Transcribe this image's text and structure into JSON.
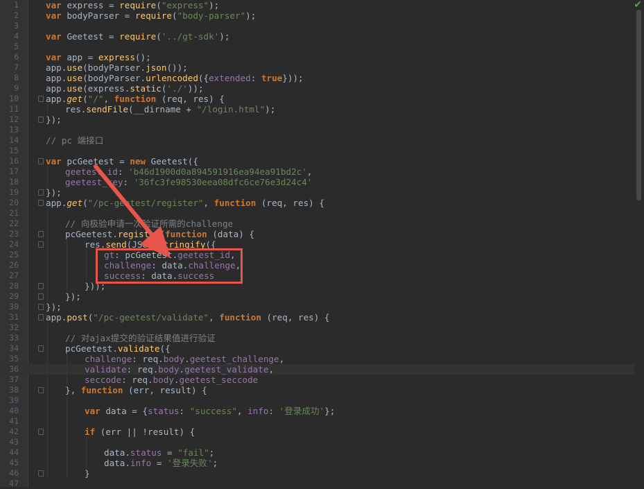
{
  "editor": {
    "accent_color": "#e8554a",
    "status_icon": "check-icon",
    "status_glyph": "✔",
    "current_line": 36,
    "lines": [
      {
        "n": "1",
        "fold": false,
        "indent": 0,
        "tokens": [
          [
            "k",
            "var"
          ],
          [
            "p",
            " express = "
          ],
          [
            "m",
            "require"
          ],
          [
            "p",
            "("
          ],
          [
            "s",
            "\"express\""
          ],
          [
            "p",
            ");"
          ]
        ]
      },
      {
        "n": "2",
        "fold": false,
        "indent": 0,
        "tokens": [
          [
            "k",
            "var"
          ],
          [
            "p",
            " bodyParser = "
          ],
          [
            "m",
            "require"
          ],
          [
            "p",
            "("
          ],
          [
            "s",
            "\"body-parser\""
          ],
          [
            "p",
            ");"
          ]
        ]
      },
      {
        "n": "3",
        "fold": false,
        "indent": 0,
        "tokens": []
      },
      {
        "n": "4",
        "fold": false,
        "indent": 0,
        "tokens": [
          [
            "k",
            "var"
          ],
          [
            "p",
            " Geetest = "
          ],
          [
            "m",
            "require"
          ],
          [
            "p",
            "("
          ],
          [
            "s",
            "'../gt-sdk'"
          ],
          [
            "p",
            ");"
          ]
        ]
      },
      {
        "n": "5",
        "fold": false,
        "indent": 0,
        "tokens": []
      },
      {
        "n": "6",
        "fold": false,
        "indent": 0,
        "tokens": [
          [
            "k",
            "var"
          ],
          [
            "p",
            " app = "
          ],
          [
            "m",
            "express"
          ],
          [
            "p",
            "();"
          ]
        ]
      },
      {
        "n": "7",
        "fold": false,
        "indent": 0,
        "tokens": [
          [
            "p",
            "app."
          ],
          [
            "m",
            "use"
          ],
          [
            "p",
            "(bodyParser."
          ],
          [
            "m",
            "json"
          ],
          [
            "p",
            "());"
          ]
        ]
      },
      {
        "n": "8",
        "fold": false,
        "indent": 0,
        "tokens": [
          [
            "p",
            "app."
          ],
          [
            "m",
            "use"
          ],
          [
            "p",
            "(bodyParser."
          ],
          [
            "m",
            "urlencoded"
          ],
          [
            "p",
            "({"
          ],
          [
            "r",
            "extended"
          ],
          [
            "p",
            ": "
          ],
          [
            "k",
            "true"
          ],
          [
            "p",
            "}));"
          ]
        ]
      },
      {
        "n": "9",
        "fold": false,
        "indent": 0,
        "tokens": [
          [
            "p",
            "app."
          ],
          [
            "m",
            "use"
          ],
          [
            "p",
            "(express."
          ],
          [
            "m",
            "static"
          ],
          [
            "p",
            "("
          ],
          [
            "s",
            "'./'"
          ],
          [
            "p",
            "));"
          ]
        ]
      },
      {
        "n": "10",
        "fold": true,
        "indent": 0,
        "tokens": [
          [
            "p",
            "app."
          ],
          [
            "i",
            "get"
          ],
          [
            "p",
            "("
          ],
          [
            "s",
            "\"/\""
          ],
          [
            "p",
            ", "
          ],
          [
            "k",
            "function"
          ],
          [
            "p",
            " (req, res) {"
          ]
        ]
      },
      {
        "n": "11",
        "fold": false,
        "indent": 1,
        "tokens": [
          [
            "p",
            "res."
          ],
          [
            "m",
            "sendFile"
          ],
          [
            "p",
            "(__dirname + "
          ],
          [
            "s",
            "\"/login.html\""
          ],
          [
            "p",
            ");"
          ]
        ]
      },
      {
        "n": "12",
        "fold": true,
        "indent": 0,
        "tokens": [
          [
            "p",
            "});"
          ]
        ]
      },
      {
        "n": "13",
        "fold": false,
        "indent": 0,
        "tokens": []
      },
      {
        "n": "14",
        "fold": false,
        "indent": 0,
        "tokens": [
          [
            "c",
            "// pc 端接口"
          ]
        ]
      },
      {
        "n": "15",
        "fold": false,
        "indent": 0,
        "tokens": []
      },
      {
        "n": "16",
        "fold": true,
        "indent": 0,
        "tokens": [
          [
            "k",
            "var"
          ],
          [
            "p",
            " pcGeetest = "
          ],
          [
            "k",
            "new"
          ],
          [
            "p",
            " Geetest({"
          ]
        ]
      },
      {
        "n": "17",
        "fold": false,
        "indent": 1,
        "tokens": [
          [
            "r",
            "geetest_id"
          ],
          [
            "p",
            ": "
          ],
          [
            "s",
            "'b46d1900d0a894591916ea94ea91bd2c'"
          ],
          [
            "p",
            ","
          ]
        ]
      },
      {
        "n": "18",
        "fold": false,
        "indent": 1,
        "tokens": [
          [
            "r",
            "geetest_key"
          ],
          [
            "p",
            ": "
          ],
          [
            "s",
            "'36fc3fe98530eea08dfc6ce76e3d24c4'"
          ]
        ]
      },
      {
        "n": "19",
        "fold": true,
        "indent": 0,
        "tokens": [
          [
            "p",
            "});"
          ]
        ]
      },
      {
        "n": "20",
        "fold": true,
        "indent": 0,
        "tokens": [
          [
            "p",
            "app."
          ],
          [
            "i",
            "get"
          ],
          [
            "p",
            "("
          ],
          [
            "s",
            "\"/pc-geetest/register\""
          ],
          [
            "p",
            ", "
          ],
          [
            "k",
            "function"
          ],
          [
            "p",
            " (req, res) {"
          ]
        ]
      },
      {
        "n": "21",
        "fold": false,
        "indent": 0,
        "tokens": []
      },
      {
        "n": "22",
        "fold": false,
        "indent": 1,
        "tokens": [
          [
            "c",
            "// 向极验申请一次验证所需的challenge"
          ]
        ]
      },
      {
        "n": "23",
        "fold": true,
        "indent": 1,
        "tokens": [
          [
            "p",
            "pcGeetest."
          ],
          [
            "m",
            "register"
          ],
          [
            "p",
            "("
          ],
          [
            "k",
            "function"
          ],
          [
            "p",
            " (data) {"
          ]
        ]
      },
      {
        "n": "24",
        "fold": true,
        "indent": 2,
        "tokens": [
          [
            "p",
            "res."
          ],
          [
            "m",
            "send"
          ],
          [
            "p",
            "(JSON."
          ],
          [
            "m",
            "stringify"
          ],
          [
            "p",
            "({"
          ]
        ]
      },
      {
        "n": "25",
        "fold": false,
        "indent": 3,
        "tokens": [
          [
            "r",
            "gt"
          ],
          [
            "p",
            ": pcGeetest."
          ],
          [
            "r",
            "geetest_id"
          ],
          [
            "p",
            ","
          ]
        ]
      },
      {
        "n": "26",
        "fold": false,
        "indent": 3,
        "tokens": [
          [
            "r",
            "challenge"
          ],
          [
            "p",
            ": data."
          ],
          [
            "r",
            "challenge"
          ],
          [
            "p",
            ","
          ]
        ]
      },
      {
        "n": "27",
        "fold": false,
        "indent": 3,
        "tokens": [
          [
            "r",
            "success"
          ],
          [
            "p",
            ": data."
          ],
          [
            "r",
            "success"
          ]
        ]
      },
      {
        "n": "28",
        "fold": true,
        "indent": 2,
        "tokens": [
          [
            "p",
            "}));"
          ]
        ]
      },
      {
        "n": "29",
        "fold": true,
        "indent": 1,
        "tokens": [
          [
            "p",
            "});"
          ]
        ]
      },
      {
        "n": "30",
        "fold": true,
        "indent": 0,
        "tokens": [
          [
            "p",
            "});"
          ]
        ]
      },
      {
        "n": "31",
        "fold": true,
        "indent": 0,
        "tokens": [
          [
            "p",
            "app."
          ],
          [
            "m",
            "post"
          ],
          [
            "p",
            "("
          ],
          [
            "s",
            "\"/pc-geetest/validate\""
          ],
          [
            "p",
            ", "
          ],
          [
            "k",
            "function"
          ],
          [
            "p",
            " (req, res) {"
          ]
        ]
      },
      {
        "n": "32",
        "fold": false,
        "indent": 0,
        "tokens": []
      },
      {
        "n": "33",
        "fold": false,
        "indent": 1,
        "tokens": [
          [
            "c",
            "// 对ajax提交的验证结果值进行验证"
          ]
        ]
      },
      {
        "n": "34",
        "fold": true,
        "indent": 1,
        "tokens": [
          [
            "p",
            "pcGeetest."
          ],
          [
            "m",
            "validate"
          ],
          [
            "p",
            "({"
          ]
        ]
      },
      {
        "n": "35",
        "fold": false,
        "indent": 2,
        "tokens": [
          [
            "r",
            "challenge"
          ],
          [
            "p",
            ": req."
          ],
          [
            "r",
            "body"
          ],
          [
            "p",
            "."
          ],
          [
            "r",
            "geetest_challenge"
          ],
          [
            "p",
            ","
          ]
        ]
      },
      {
        "n": "36",
        "fold": false,
        "indent": 2,
        "tokens": [
          [
            "r",
            "validate"
          ],
          [
            "p",
            ": req."
          ],
          [
            "r",
            "body"
          ],
          [
            "p",
            "."
          ],
          [
            "r",
            "geetest_validate"
          ],
          [
            "p",
            ","
          ]
        ]
      },
      {
        "n": "37",
        "fold": false,
        "indent": 2,
        "tokens": [
          [
            "r",
            "seccode"
          ],
          [
            "p",
            ": req."
          ],
          [
            "r",
            "body"
          ],
          [
            "p",
            "."
          ],
          [
            "r",
            "geetest_seccode"
          ]
        ]
      },
      {
        "n": "38",
        "fold": true,
        "indent": 1,
        "tokens": [
          [
            "p",
            "}, "
          ],
          [
            "k",
            "function"
          ],
          [
            "p",
            " (err, result) {"
          ]
        ]
      },
      {
        "n": "39",
        "fold": false,
        "indent": 0,
        "tokens": []
      },
      {
        "n": "40",
        "fold": false,
        "indent": 2,
        "tokens": [
          [
            "k",
            "var"
          ],
          [
            "p",
            " data = {"
          ],
          [
            "r",
            "status"
          ],
          [
            "p",
            ": "
          ],
          [
            "s",
            "\"success\""
          ],
          [
            "p",
            ", "
          ],
          [
            "r",
            "info"
          ],
          [
            "p",
            ": "
          ],
          [
            "s",
            "'登录成功'"
          ],
          [
            "p",
            "};"
          ]
        ]
      },
      {
        "n": "41",
        "fold": false,
        "indent": 0,
        "tokens": []
      },
      {
        "n": "42",
        "fold": true,
        "indent": 2,
        "tokens": [
          [
            "k",
            "if"
          ],
          [
            "p",
            " (err || !result) {"
          ]
        ]
      },
      {
        "n": "43",
        "fold": false,
        "indent": 0,
        "tokens": []
      },
      {
        "n": "44",
        "fold": false,
        "indent": 3,
        "tokens": [
          [
            "p",
            "data."
          ],
          [
            "r",
            "status"
          ],
          [
            "p",
            " = "
          ],
          [
            "s",
            "\"fail\""
          ],
          [
            "p",
            ";"
          ]
        ]
      },
      {
        "n": "45",
        "fold": false,
        "indent": 3,
        "tokens": [
          [
            "p",
            "data."
          ],
          [
            "r",
            "info"
          ],
          [
            "p",
            " = "
          ],
          [
            "s",
            "'登录失败'"
          ],
          [
            "p",
            ";"
          ]
        ]
      },
      {
        "n": "46",
        "fold": true,
        "indent": 2,
        "tokens": [
          [
            "p",
            "}"
          ]
        ]
      },
      {
        "n": "47",
        "fold": false,
        "indent": 0,
        "tokens": []
      }
    ]
  }
}
